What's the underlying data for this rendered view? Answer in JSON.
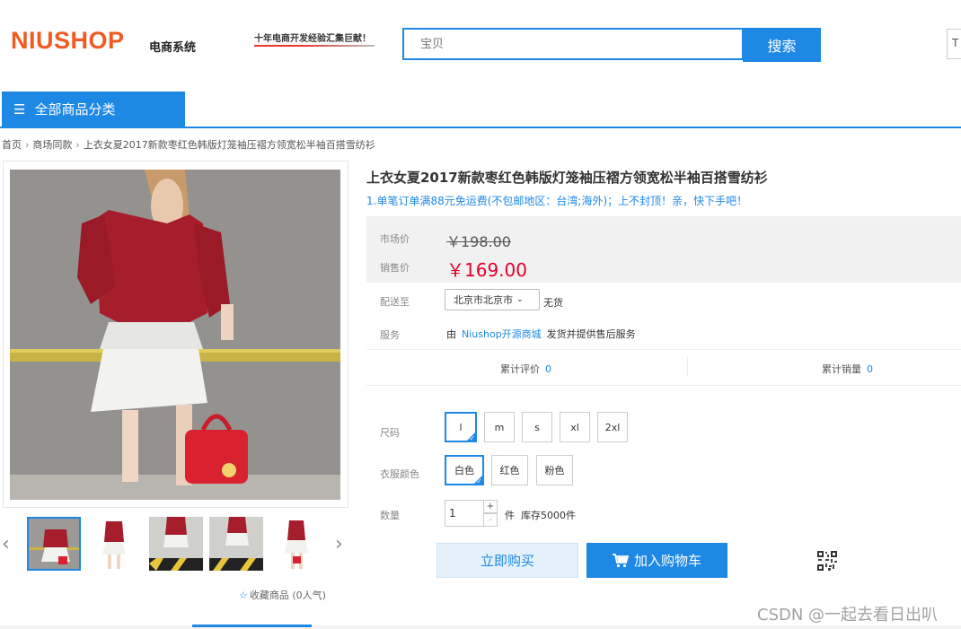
{
  "header": {
    "logo_text": "NIUSHOP",
    "logo_sub": "电商系统",
    "slogan": "十年电商开发经验汇集巨献！",
    "search_placeholder": "宝贝",
    "search_button": "搜索",
    "top_right_text": "T"
  },
  "nav": {
    "category_label": "全部商品分类"
  },
  "breadcrumb": [
    "首页",
    "商场同款",
    "上衣女夏2017新款枣红色韩版灯笼袖压褶方领宽松半袖百搭雪纺衫"
  ],
  "product": {
    "title": "上衣女夏2017新款枣红色韩版灯笼袖压褶方领宽松半袖百搭雪纺衫",
    "promo": "1.单笔订单满88元免运费(不包邮地区：台湾;海外)；上不封顶！亲，快下手吧！",
    "market_price_label": "市场价",
    "market_price": "￥198.00",
    "sale_price_label": "销售价",
    "sale_price": "￥169.00",
    "ship_label": "配送至",
    "ship_region": "北京市北京市",
    "stock_state": "无货",
    "service_label": "服务",
    "service_prefix": "由",
    "service_shop": "Niushop开源商城",
    "service_suffix": "发货并提供售后服务",
    "reviews_label": "累计评价",
    "reviews_count": "0",
    "sales_label": "累计销量",
    "sales_count": "0",
    "size_label": "尺码",
    "sizes": [
      "l",
      "m",
      "s",
      "xl",
      "2xl"
    ],
    "selected_size": "l",
    "color_label": "衣服颜色",
    "colors": [
      "白色",
      "红色",
      "粉色"
    ],
    "selected_color": "白色",
    "qty_label": "数量",
    "qty_value": "1",
    "qty_plus": "+",
    "qty_minus": "-",
    "qty_unit": "件",
    "stock_text": "库存5000件",
    "buy_now": "立即购买",
    "add_cart": "加入购物车",
    "favorite": "收藏商品 (0人气)"
  },
  "thumbnails": [
    "thumb-1",
    "thumb-2",
    "thumb-3",
    "thumb-4",
    "thumb-5"
  ],
  "watermark": "CSDN @一起去看日出叭",
  "colors": {
    "accent": "#1e88e5",
    "price_red": "#e4002b",
    "logo_orange": "#f15a22"
  }
}
